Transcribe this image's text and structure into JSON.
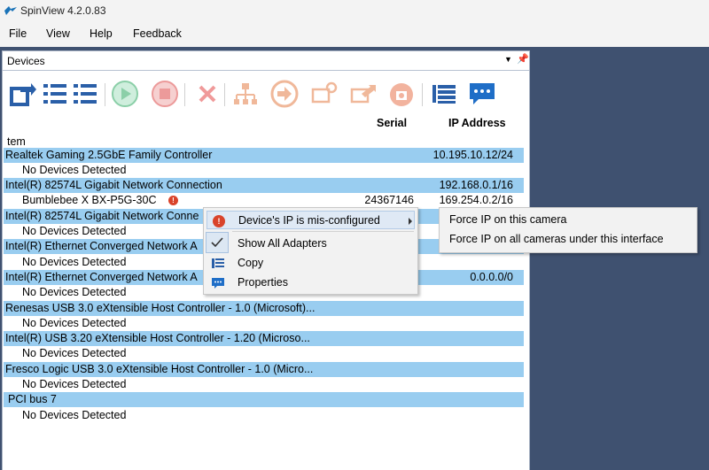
{
  "window": {
    "title": "SpinView 4.2.0.83"
  },
  "menu": [
    "File",
    "View",
    "Help",
    "Feedback"
  ],
  "panel": {
    "title": "Devices"
  },
  "columns": {
    "serial": "Serial",
    "ip": "IP Address"
  },
  "tree_root": "tem",
  "rows": [
    {
      "type": "adapter",
      "name": "Realtek Gaming 2.5GbE Family Controller",
      "ip": "10.195.10.12/24"
    },
    {
      "type": "child",
      "name": "No Devices Detected"
    },
    {
      "type": "adapter",
      "name": "Intel(R) 82574L Gigabit Network Connection",
      "ip": "192.168.0.1/16"
    },
    {
      "type": "camera",
      "name": "Bumblebee X BX-P5G-30C",
      "serial": "24367146",
      "ip": "169.254.0.2/16"
    },
    {
      "type": "adapter",
      "name": "Intel(R) 82574L Gigabit Network Conne",
      "ip": ""
    },
    {
      "type": "child",
      "name": "No Devices Detected"
    },
    {
      "type": "adapter",
      "name": "Intel(R) Ethernet Converged Network A",
      "ip": ""
    },
    {
      "type": "child",
      "name": "No Devices Detected"
    },
    {
      "type": "adapter",
      "name": "Intel(R) Ethernet Converged Network A",
      "ip": "0.0.0.0/0"
    },
    {
      "type": "child",
      "name": "No Devices Detected"
    },
    {
      "type": "adapter",
      "name": "Renesas USB 3.0 eXtensible Host Controller - 1.0 (Microsoft)...",
      "ip": ""
    },
    {
      "type": "child",
      "name": "No Devices Detected"
    },
    {
      "type": "adapter",
      "name": "Intel(R) USB 3.20 eXtensible Host Controller - 1.20 (Microso...",
      "ip": ""
    },
    {
      "type": "child",
      "name": "No Devices Detected"
    },
    {
      "type": "adapter",
      "name": "Fresco Logic USB 3.0 eXtensible Host Controller - 1.0 (Micro...",
      "ip": ""
    },
    {
      "type": "child",
      "name": "No Devices Detected"
    },
    {
      "type": "adapter",
      "name": "PCI bus 7",
      "ip": ""
    },
    {
      "type": "child",
      "name": "No Devices Detected"
    }
  ],
  "context_menu": {
    "misconfigured": "Device's IP is mis-configured",
    "show_all": "Show All Adapters",
    "copy": "Copy",
    "properties": "Properties"
  },
  "submenu": {
    "force_camera": "Force IP on this camera",
    "force_all": "Force IP on all cameras under this interface"
  },
  "colors": {
    "row_highlight": "#99cdf0",
    "background": "#3f5170",
    "warning": "#d9432a"
  }
}
